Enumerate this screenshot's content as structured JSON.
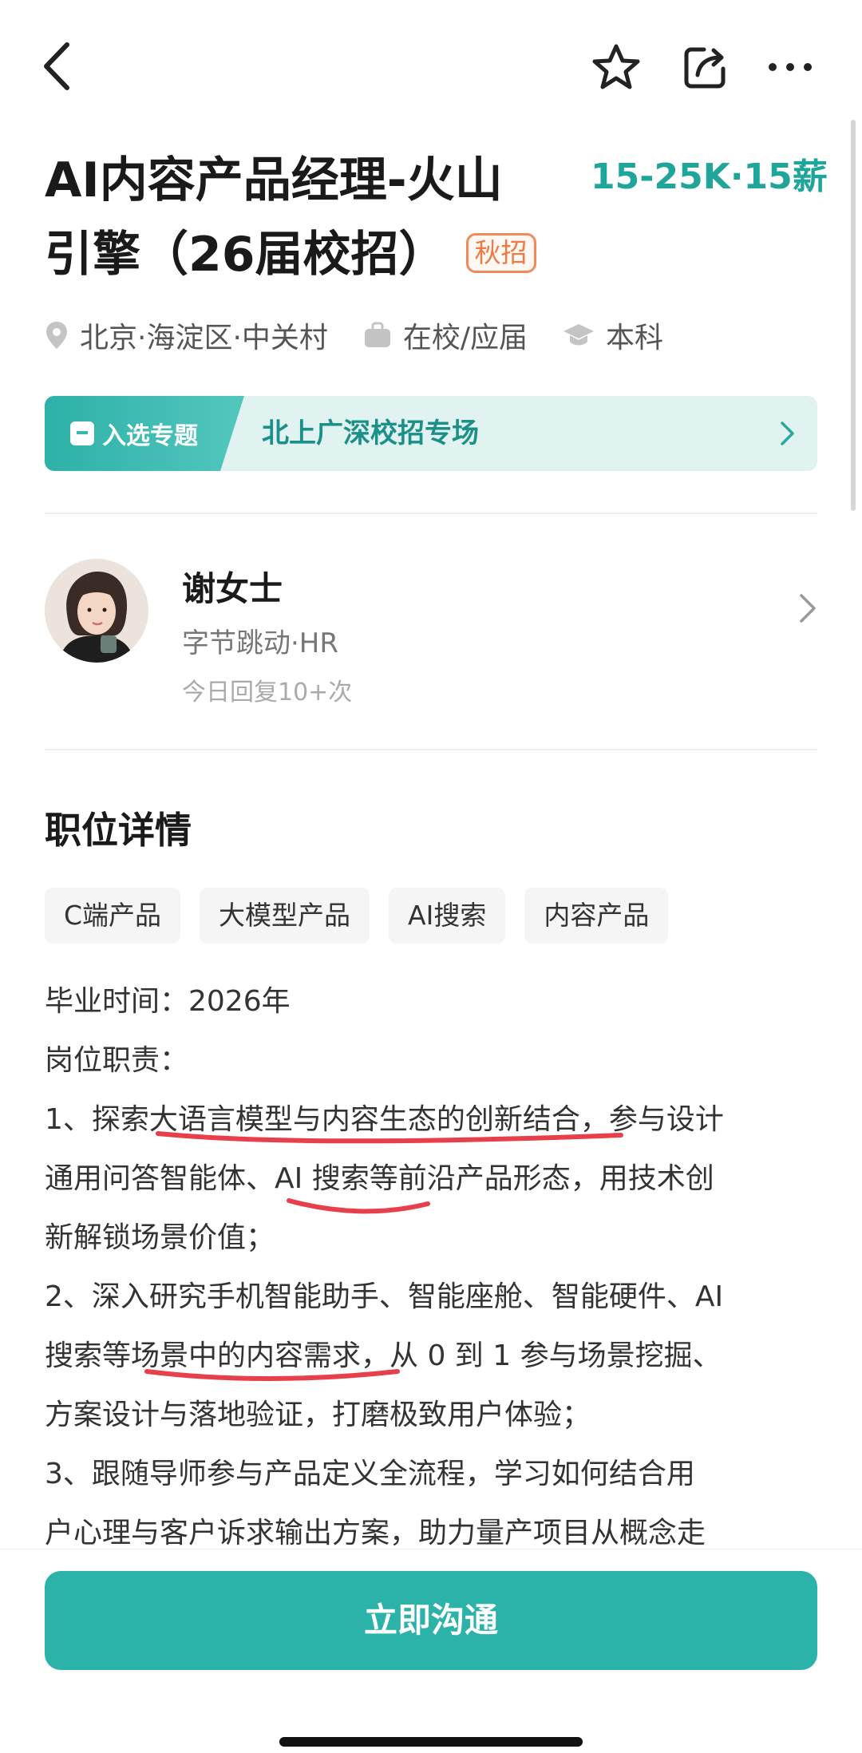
{
  "job": {
    "title_line1": "AI内容产品经理-火山",
    "title_line2": "引擎（26届校招）",
    "badge": "秋招",
    "salary": "15-25K·15薪",
    "location": "北京·海淀区·中关村",
    "experience": "在校/应届",
    "education": "本科"
  },
  "topic": {
    "tag_label": "入选专题",
    "name": "北上广深校招专场"
  },
  "recruiter": {
    "name": "谢女士",
    "company_role": "字节跳动·HR",
    "reply_info": "今日回复10+次"
  },
  "details": {
    "section_title": "职位详情",
    "tags": [
      "C端产品",
      "大模型产品",
      "AI搜索",
      "内容产品"
    ],
    "lines": [
      "毕业时间：2026年",
      "岗位职责：",
      "1、探索大语言模型与内容生态的创新结合，参与设计",
      "通用问答智能体、AI 搜索等前沿产品形态，用技术创",
      "新解锁场景价值；",
      "2、深入研究手机智能助手、智能座舱、智能硬件、AI",
      "搜索等场景中的内容需求，从 0 到 1 参与场景挖掘、",
      "方案设计与落地验证，打磨极致用户体验；",
      "3、跟随导师参与产品定义全流程，学习如何结合用",
      "户心理与客户诉求输出方案，助力量产项目从概念走"
    ]
  },
  "cta": {
    "label": "立即沟通"
  },
  "icons": {
    "back": "back-arrow-icon",
    "favorite": "star-icon",
    "share": "share-icon",
    "more": "more-icon",
    "location": "location-pin-icon",
    "experience": "briefcase-icon",
    "education": "graduation-cap-icon"
  },
  "colors": {
    "accent": "#2bb3a9",
    "salary": "#20a59b",
    "badge": "#ee7a45",
    "underline": "#e8404a"
  }
}
